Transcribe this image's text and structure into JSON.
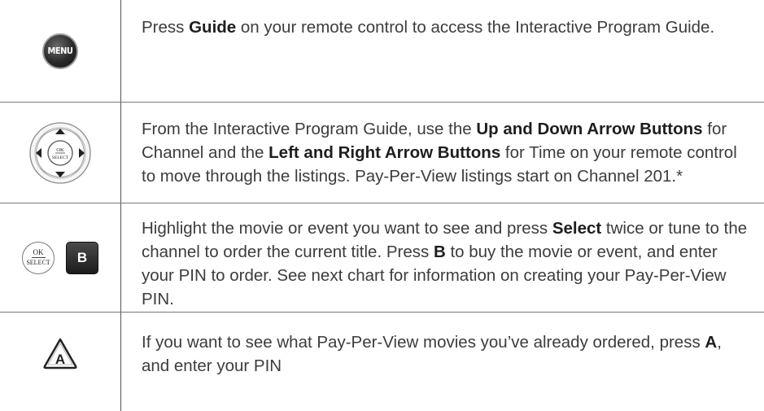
{
  "rows": [
    {
      "icons": [
        "menu-button-icon"
      ],
      "menu_label": "MENU",
      "text": {
        "t1": "Press ",
        "b1": "Guide",
        "t2": " on your remote control to access the Interactive Program Guide."
      }
    },
    {
      "icons": [
        "directional-pad-icon"
      ],
      "ok_label": "OK",
      "select_label": "SELECT",
      "text": {
        "t1": "From the Interactive Program Guide, use the ",
        "b1": "Up and Down Arrow Buttons",
        "t2": " for Channel and the ",
        "b2": "Left and Right Arrow Buttons",
        "t3": " for Time on your remote control to move through the listings. Pay-Per-View listings start on Channel 201.*"
      }
    },
    {
      "icons": [
        "ok-select-button-icon",
        "b-button-icon"
      ],
      "ok_label": "OK",
      "select_label": "SELECT",
      "b_label": "B",
      "text": {
        "t1": "Highlight the movie or event you want to see and press ",
        "b1": "Select",
        "t2": " twice or tune to the channel to order the current title. Press ",
        "b2": "B",
        "t3": " to buy the movie or event, and enter your PIN to order. See next chart for information on creating your Pay-Per-View PIN."
      }
    },
    {
      "icons": [
        "a-button-icon"
      ],
      "a_label": "A",
      "text": {
        "t1": "If you want to see what Pay-Per-View movies you’ve already ordered, press ",
        "b1": "A",
        "t2": ", and enter your PIN"
      }
    }
  ]
}
